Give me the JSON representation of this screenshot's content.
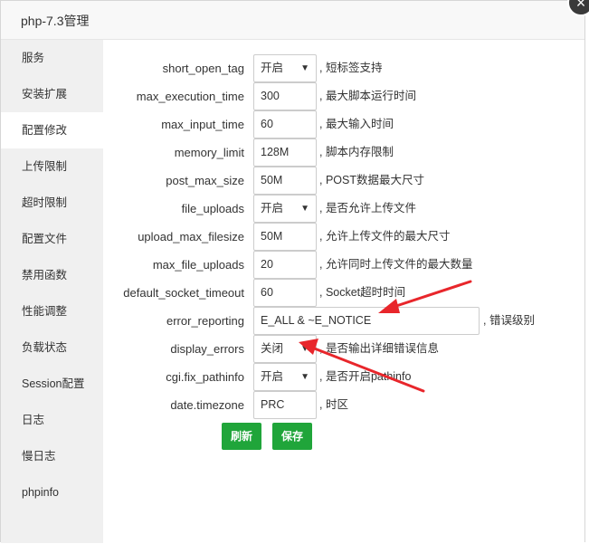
{
  "dialog": {
    "title": "php-7.3管理",
    "close_glyph": "×"
  },
  "sidebar": {
    "items": [
      {
        "label": "服务"
      },
      {
        "label": "安装扩展"
      },
      {
        "label": "配置修改"
      },
      {
        "label": "上传限制"
      },
      {
        "label": "超时限制"
      },
      {
        "label": "配置文件"
      },
      {
        "label": "禁用函数"
      },
      {
        "label": "性能调整"
      },
      {
        "label": "负载状态"
      },
      {
        "label": "Session配置"
      },
      {
        "label": "日志"
      },
      {
        "label": "慢日志"
      },
      {
        "label": "phpinfo"
      }
    ],
    "active_index": 2
  },
  "settings": [
    {
      "label": "short_open_tag",
      "value": "开启",
      "type": "select",
      "desc": ", 短标签支持"
    },
    {
      "label": "max_execution_time",
      "value": "300",
      "type": "text",
      "desc": ", 最大脚本运行时间"
    },
    {
      "label": "max_input_time",
      "value": "60",
      "type": "text",
      "desc": ", 最大输入时间"
    },
    {
      "label": "memory_limit",
      "value": "128M",
      "type": "text",
      "desc": ", 脚本内存限制"
    },
    {
      "label": "post_max_size",
      "value": "50M",
      "type": "text",
      "desc": ", POST数据最大尺寸"
    },
    {
      "label": "file_uploads",
      "value": "开启",
      "type": "select",
      "desc": ", 是否允许上传文件"
    },
    {
      "label": "upload_max_filesize",
      "value": "50M",
      "type": "text",
      "desc": ", 允许上传文件的最大尺寸"
    },
    {
      "label": "max_file_uploads",
      "value": "20",
      "type": "text",
      "desc": ", 允许同时上传文件的最大数量"
    },
    {
      "label": "default_socket_timeout",
      "value": "60",
      "type": "text",
      "desc": ", Socket超时时间"
    },
    {
      "label": "error_reporting",
      "value": "E_ALL & ~E_NOTICE",
      "type": "wide",
      "desc": ", 错误级别"
    },
    {
      "label": "display_errors",
      "value": "关闭",
      "type": "select",
      "desc": ", 是否输出详细错误信息"
    },
    {
      "label": "cgi.fix_pathinfo",
      "value": "开启",
      "type": "select",
      "desc": ", 是否开启pathinfo"
    },
    {
      "label": "date.timezone",
      "value": "PRC",
      "type": "text",
      "desc": ", 时区"
    }
  ],
  "select_caret": "▼",
  "buttons": {
    "refresh": "刷新",
    "save": "保存"
  },
  "colors": {
    "accent": "#20a53a",
    "annotation": "#e8262b",
    "sidebar_bg": "#f0f0f0"
  }
}
